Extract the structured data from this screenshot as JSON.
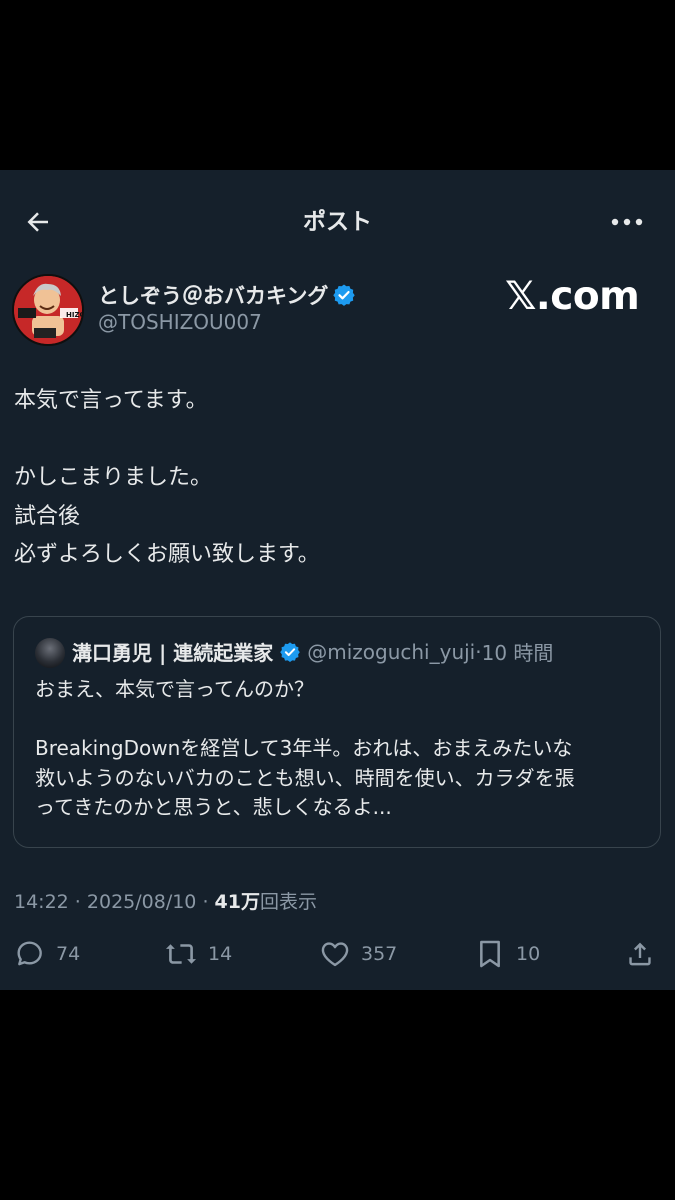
{
  "header": {
    "title": "ポスト",
    "back_icon": "arrow-left-icon",
    "more_icon": "more-horizontal-icon"
  },
  "author": {
    "name": "としぞう＠おバカキング",
    "handle": "@TOSHIZOU007",
    "avatar_text": "TOSHIZO"
  },
  "brand": "𝕏.com",
  "tweet": {
    "lines": [
      "本気で言ってます。",
      "",
      "かしこまりました。",
      "試合後",
      "必ずよろしくお願い致します。"
    ]
  },
  "quote": {
    "name": "溝口勇児 | 連続起業家",
    "handle": "@mizoguchi_yuji",
    "separator": "·",
    "time": "10 時間",
    "lines": [
      "おまえ、本気で言ってんのか？",
      "",
      "BreakingDownを経営して3年半。おれは、おまえみたいな",
      "救いようのないバカのことも想い、時間を使い、カラダを張",
      "ってきたのかと思うと、悲しくなるよ..."
    ]
  },
  "meta": {
    "time": "14:22",
    "sep1": " · ",
    "date": "2025/08/10",
    "sep2": " · ",
    "views_count": "41万",
    "views_label": "回表示"
  },
  "actions": {
    "replies": "74",
    "reposts": "14",
    "likes": "357",
    "bookmarks": "10"
  },
  "colors": {
    "background": "#15202b",
    "verified": "#1d9bf0",
    "secondary_text": "#8b98a5"
  }
}
